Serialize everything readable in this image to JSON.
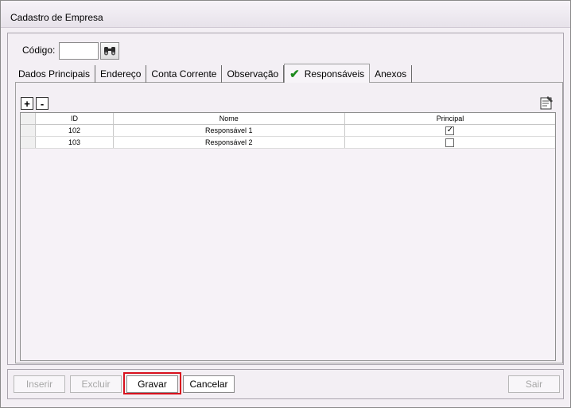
{
  "window": {
    "title": "Cadastro de Empresa"
  },
  "codigo": {
    "label": "Código:",
    "value": ""
  },
  "tabs": [
    {
      "label": "Dados Principais",
      "active": false
    },
    {
      "label": "Endereço",
      "active": false
    },
    {
      "label": "Conta Corrente",
      "active": false
    },
    {
      "label": "Observação",
      "active": false
    },
    {
      "label": "Responsáveis",
      "active": true,
      "icon": "checkmark-icon"
    },
    {
      "label": "Anexos",
      "active": false
    }
  ],
  "toolbar": {
    "add_label": "+",
    "remove_label": "-",
    "report_icon": "report-icon"
  },
  "grid": {
    "columns": [
      "ID",
      "Nome",
      "Principal"
    ],
    "rows": [
      {
        "id": "102",
        "nome": "Responsável 1",
        "principal": true
      },
      {
        "id": "103",
        "nome": "Responsável 2",
        "principal": false
      }
    ]
  },
  "buttons": {
    "inserir": "Inserir",
    "excluir": "Excluir",
    "gravar": "Gravar",
    "cancelar": "Cancelar",
    "sair": "Sair"
  },
  "colors": {
    "highlight": "#d8101d",
    "checkmark": "#1e8a1e"
  }
}
